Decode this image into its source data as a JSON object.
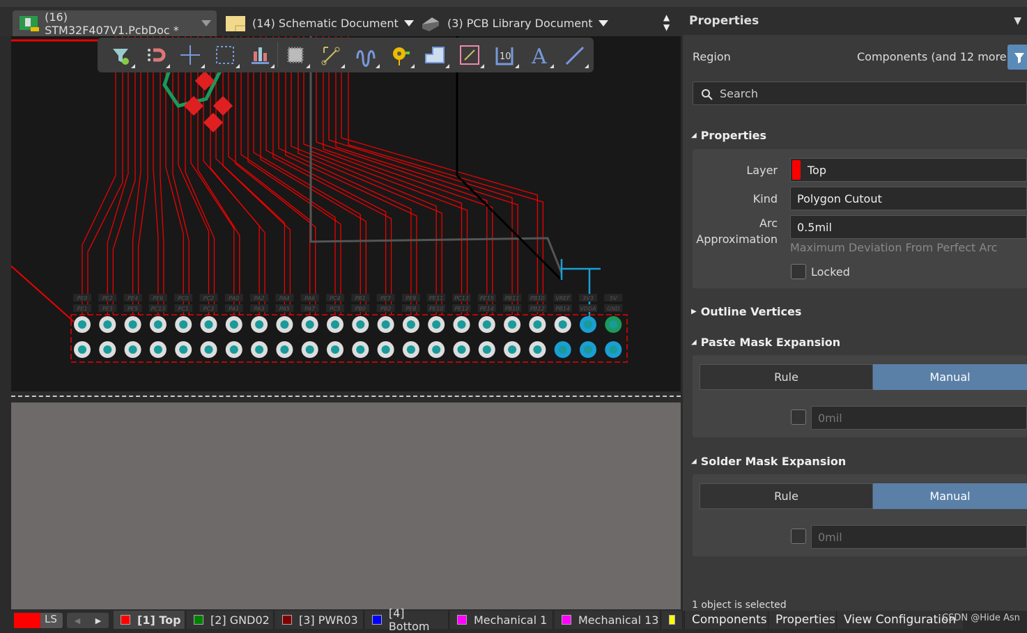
{
  "tabs": [
    {
      "label": "(16) STM32F407V1.PcbDoc *",
      "icon": "pcb-doc-icon",
      "active": true
    },
    {
      "label": "(14) Schematic Document",
      "icon": "schematic-doc-icon"
    },
    {
      "label": "(3) PCB Library Document",
      "icon": "pcb-library-icon"
    }
  ],
  "toolbar": [
    "filter",
    "interactive-routing-magnet",
    "move",
    "select-rectangle",
    "align",
    "place-component",
    "route-track",
    "differential-pair",
    "place-via",
    "place-polygon",
    "place-line",
    "dimension",
    "place-string",
    "place-line-draw"
  ],
  "silkscreen": {
    "top": [
      "PE0",
      "PE2",
      "PE4",
      "PE6",
      "PC0",
      "PC2",
      "PA0",
      "PA2",
      "PA4",
      "PA6",
      "PC4",
      "PB1",
      "PE7",
      "PE9",
      "PE11",
      "PC13",
      "PE15",
      "PB11",
      "PB10",
      "VREF",
      "3V3",
      "5V"
    ],
    "bottom": [
      "PE1",
      "PE3",
      "PE5",
      "PC13",
      "PC1",
      "PC3",
      "PA1",
      "PA3",
      "PA5",
      "PA7",
      "PC5",
      "PB0",
      "PB2",
      "PE8",
      "PE10",
      "PE12",
      "PE14",
      "PB10",
      "PB12",
      "PB14",
      "VDDA",
      "GND"
    ]
  },
  "panel": {
    "title": "Properties",
    "region_label": "Region",
    "region_value": "Components (and 12 more)",
    "search_placeholder": "Search",
    "properties_section": "Properties",
    "layer_label": "Layer",
    "layer_value": "Top",
    "layer_color": "#ff0000",
    "kind_label": "Kind",
    "kind_value": "Polygon Cutout",
    "arc_label_1": "Arc",
    "arc_label_2": "Approximation",
    "arc_value": "0.5mil",
    "arc_hint": "Maximum Deviation From Perfect Arc",
    "locked_label": "Locked",
    "outline_section": "Outline Vertices",
    "paste_section": "Paste Mask Expansion",
    "paste_rule": "Rule",
    "paste_manual": "Manual",
    "paste_value": "0mil",
    "solder_section": "Solder Mask Expansion",
    "solder_rule": "Rule",
    "solder_manual": "Manual",
    "solder_value": "0mil",
    "selection_status": "1 object is selected"
  },
  "statusbar": {
    "ls": "LS",
    "layers": [
      {
        "label": "[1] Top",
        "color": "#ff0000",
        "active": true
      },
      {
        "label": "[2] GND02",
        "color": "#008000"
      },
      {
        "label": "[3] PWR03",
        "color": "#800000"
      },
      {
        "label": "[4] Bottom",
        "color": "#0000ff"
      },
      {
        "label": "Mechanical 1",
        "color": "#ff00ff"
      },
      {
        "label": "Mechanical 13",
        "color": "#ff00ff"
      },
      {
        "label": "",
        "color": "#ffff00"
      }
    ],
    "panel_tabs": [
      "Components",
      "Properties",
      "View Configuration"
    ],
    "watermark": "CSDN @Hide Asn"
  }
}
